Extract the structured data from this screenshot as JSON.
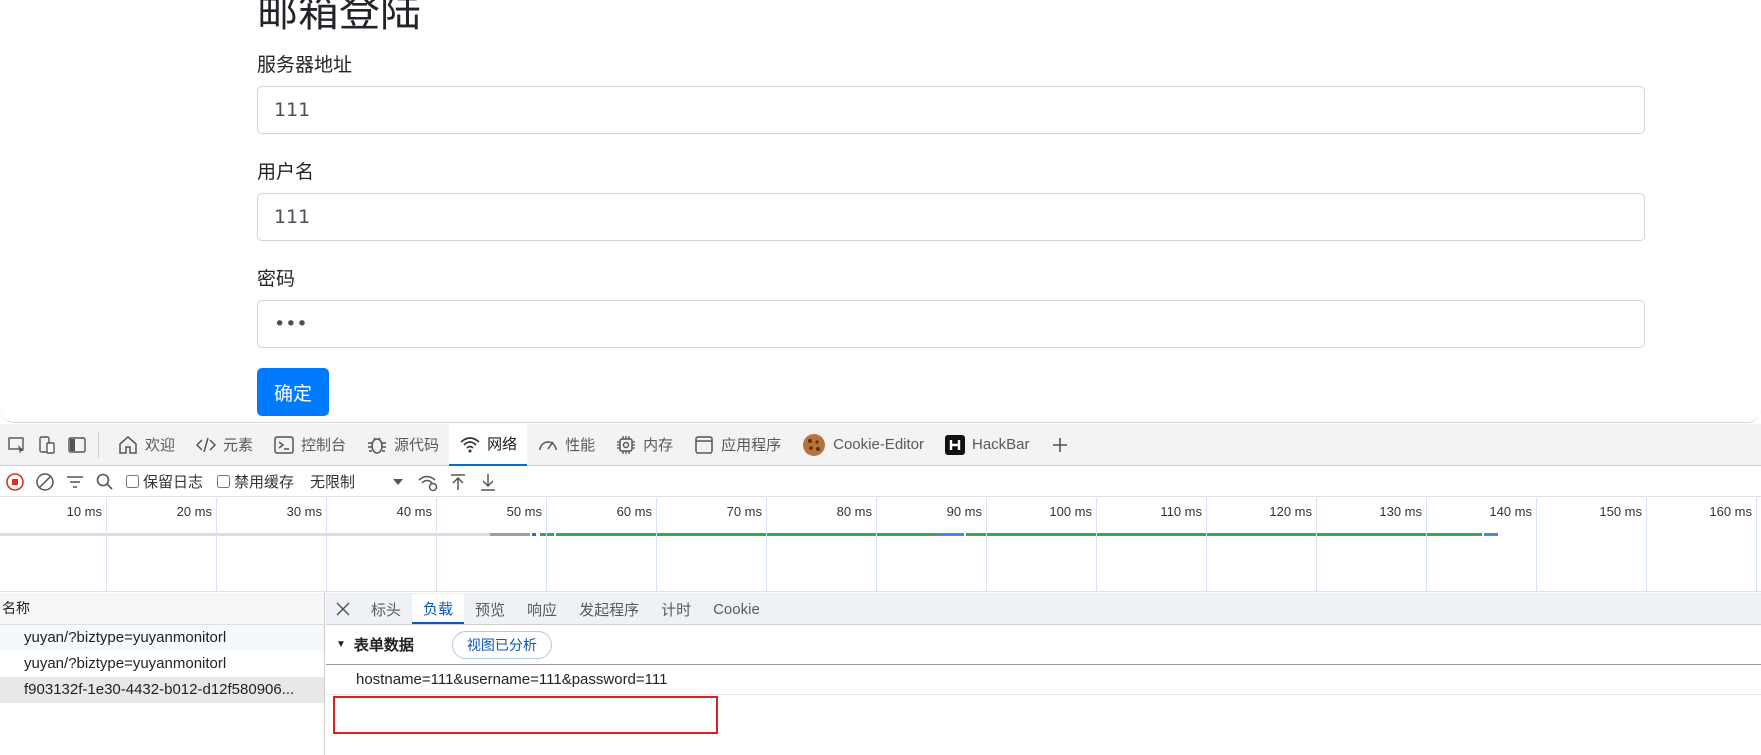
{
  "login": {
    "title": "邮箱登陆",
    "hostname_label": "服务器地址",
    "hostname_value": "111",
    "username_label": "用户名",
    "username_value": "111",
    "password_label": "密码",
    "password_value": "•••",
    "submit_label": "确定",
    "accent": "#007bff"
  },
  "devtools": {
    "tabs": [
      {
        "label": "欢迎",
        "icon": "home-icon"
      },
      {
        "label": "元素",
        "icon": "code-icon"
      },
      {
        "label": "控制台",
        "icon": "console-icon"
      },
      {
        "label": "源代码",
        "icon": "bug-icon"
      },
      {
        "label": "网络",
        "icon": "wifi-icon"
      },
      {
        "label": "性能",
        "icon": "gauge-icon"
      },
      {
        "label": "内存",
        "icon": "chip-icon"
      },
      {
        "label": "应用程序",
        "icon": "window-icon"
      },
      {
        "label": "Cookie-Editor",
        "icon": "cookie-icon"
      },
      {
        "label": "HackBar",
        "icon": "hackbar-icon"
      }
    ],
    "toolbar": {
      "preserve_log": "保留日志",
      "disable_cache": "禁用缓存",
      "throttling": "无限制"
    },
    "timeline_ticks": [
      "10 ms",
      "20 ms",
      "30 ms",
      "40 ms",
      "50 ms",
      "60 ms",
      "70 ms",
      "80 ms",
      "90 ms",
      "100 ms",
      "110 ms",
      "120 ms",
      "130 ms",
      "140 ms",
      "150 ms",
      "160 ms"
    ],
    "requests": {
      "header": "名称",
      "rows": [
        "yuyan/?biztype=yuyanmonitorl",
        "yuyan/?biztype=yuyanmonitorl",
        "f903132f-1e30-4432-b012-d12f580906..."
      ]
    },
    "detail": {
      "tabs": [
        "标头",
        "负载",
        "预览",
        "响应",
        "发起程序",
        "计时",
        "Cookie"
      ],
      "active_tab": "负载",
      "section_title": "表单数据",
      "view_button": "视图已分析",
      "payload": "hostname=111&username=111&password=111"
    }
  }
}
